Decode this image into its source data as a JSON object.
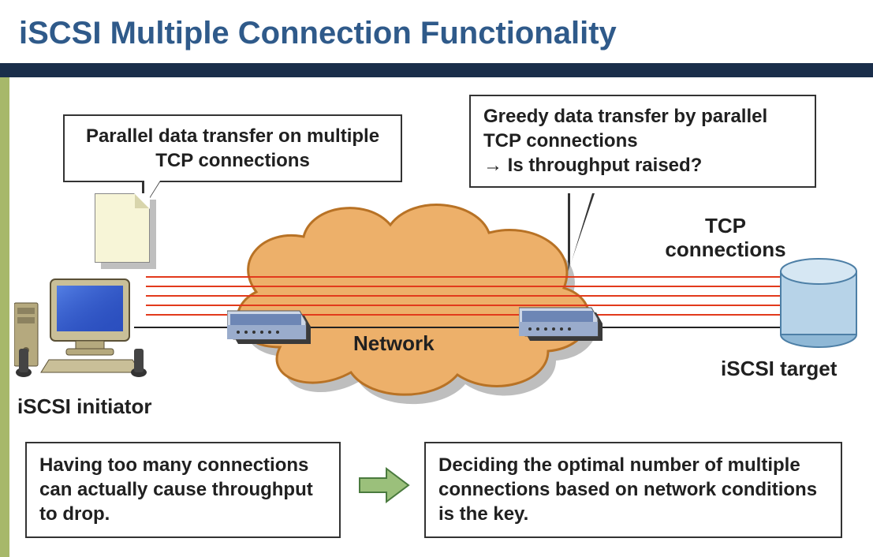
{
  "title": "iSCSI Multiple Connection Functionality",
  "callouts": {
    "left": "Parallel data transfer on multiple TCP connections",
    "right_line1": "Greedy data transfer by parallel TCP connections",
    "right_line2": "→ Is throughput raised?"
  },
  "labels": {
    "network": "Network",
    "tcp_connections": "TCP connections",
    "initiator": "iSCSI initiator",
    "target": "iSCSI target"
  },
  "bottom": {
    "left_box": "Having too many connections can actually cause throughput to drop.",
    "right_box": "Deciding the optimal number of multiple connections based on network conditions is the key."
  },
  "icons": {
    "document": "document-icon",
    "cloud": "cloud-network-icon",
    "router_left": "router-icon",
    "router_right": "router-icon",
    "pc": "desktop-computer-icon",
    "cylinder": "storage-cylinder-icon",
    "arrow": "right-arrow-icon"
  },
  "colors": {
    "title": "#2f5a8a",
    "underline": "#1a2e4a",
    "accent": "#a7b86a",
    "cloud_fill": "#edb06a",
    "cloud_stroke": "#b87225",
    "connection_line": "#e23a1c",
    "router_fill": "#6d86b5",
    "cylinder_fill": "#b7d3e8",
    "arrow_fill": "#9bc07b"
  },
  "connection_count": 5
}
